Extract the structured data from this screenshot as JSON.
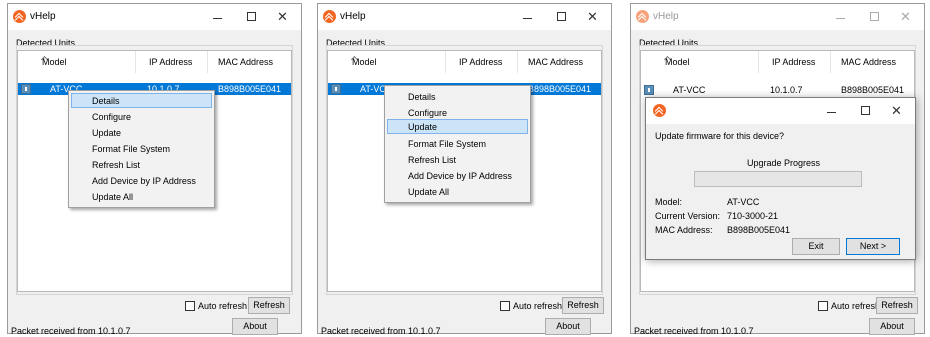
{
  "app": {
    "title": "vHelp"
  },
  "group_label": "Detected Units",
  "columns": {
    "model": "Model",
    "ip": "IP Address",
    "mac": "MAC Address"
  },
  "device": {
    "model": "AT-VCC",
    "ip": "10.1.0.7",
    "mac": "B898B005E041"
  },
  "win2_partial_model": "AT-VC",
  "auto_refresh_label": "Auto refresh",
  "auto_refresh_checked": false,
  "refresh_label": "Refresh",
  "about_label": "About",
  "status_text": "Packet received from 10.1.0.7",
  "context_menu": [
    "Details",
    "Configure",
    "Update",
    "Format File System",
    "Refresh List",
    "Add Device by IP Address",
    "Update All"
  ],
  "highlighted": {
    "win1": "Details",
    "win2": "Update"
  },
  "update_dialog": {
    "prompt": "Update firmware for this device?",
    "progress_label": "Upgrade Progress",
    "progress": 0,
    "model_label": "Model:",
    "model_value": "AT-VCC",
    "version_label": "Current Version:",
    "version_value": "710-3000-21",
    "mac_label": "MAC Address:",
    "mac_value": "B898B005E041",
    "exit_label": "Exit",
    "next_label": "Next >"
  },
  "colors": {
    "selection": "#0078d7",
    "menu_highlight": "#cce4f7",
    "app_icon": "#f26522",
    "progress_fill": "#06b025"
  },
  "icons": {
    "app": "vhelp-app-icon",
    "device": "device-icon",
    "minimize": "minimize-icon",
    "maximize": "maximize-icon",
    "close": "close-icon"
  }
}
